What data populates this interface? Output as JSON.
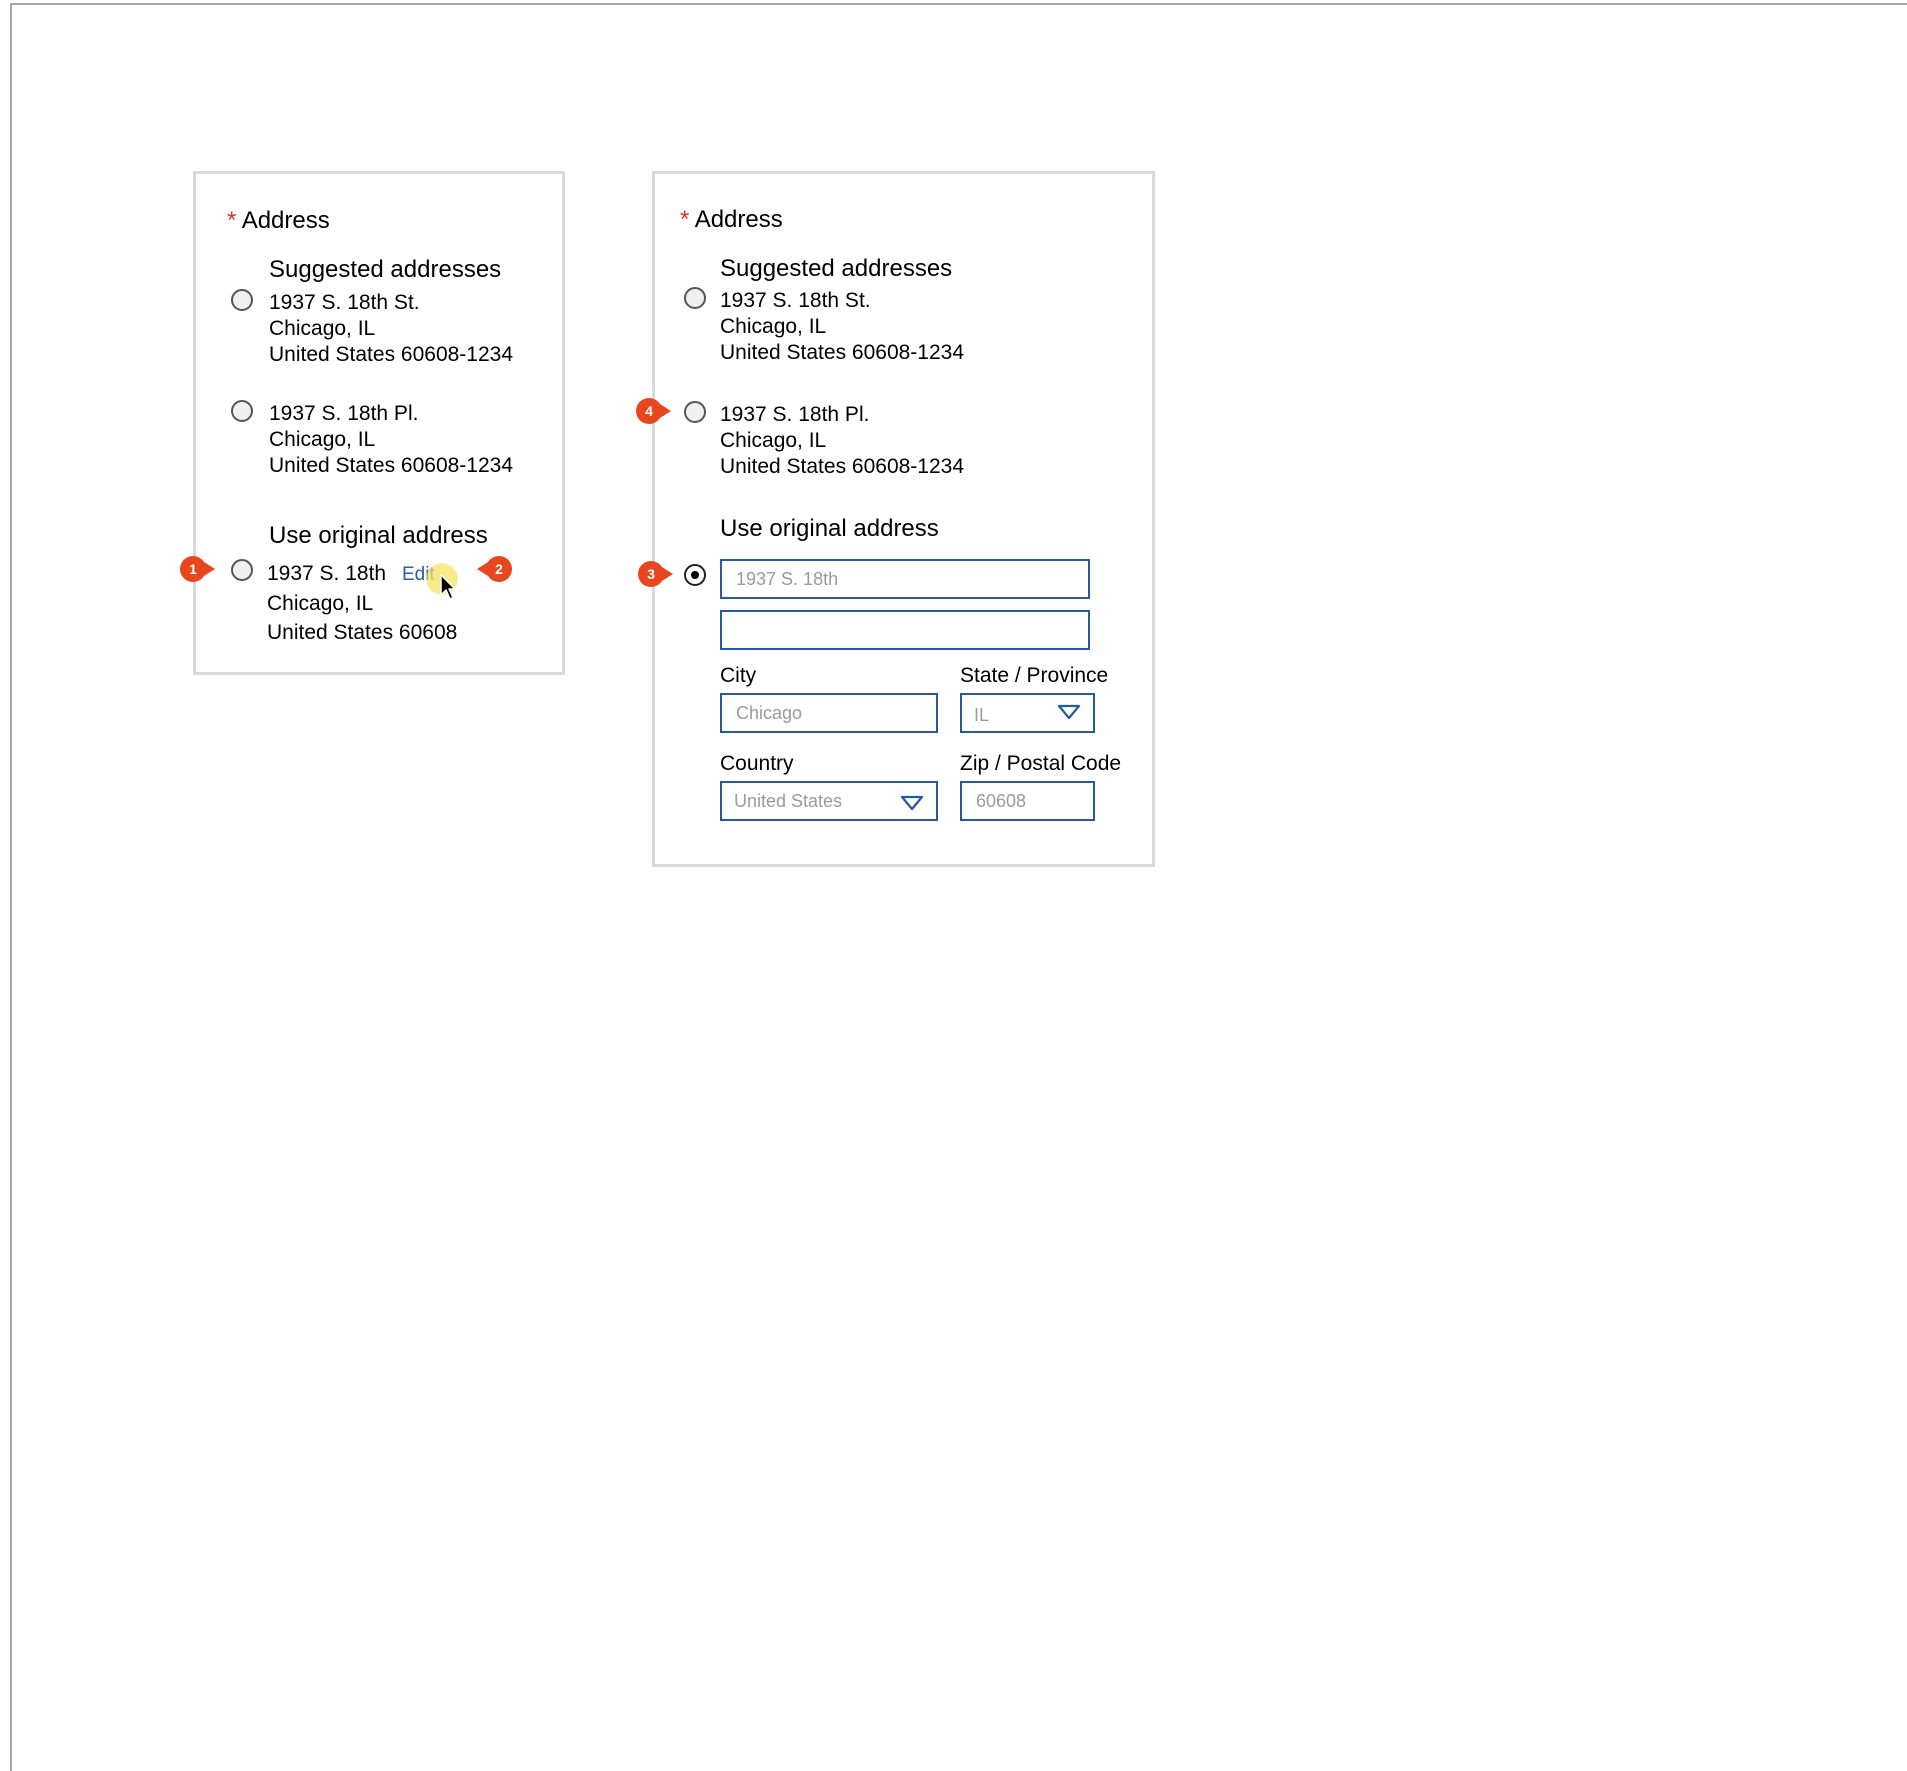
{
  "left_panel": {
    "title": "Address",
    "required_mark": "*",
    "suggested_heading": "Suggested addresses",
    "suggestions": [
      {
        "line1": "1937 S. 18th St.",
        "line2": "Chicago, IL",
        "line3": "United States  60608-1234",
        "selected": false
      },
      {
        "line1": "1937 S. 18th Pl.",
        "line2": "Chicago, IL",
        "line3": "United States  60608-1234",
        "selected": false
      }
    ],
    "original_heading": "Use original address",
    "original": {
      "line1": "1937 S. 18th",
      "line2": "Chicago, IL",
      "line3": "United States 60608",
      "selected": false
    },
    "edit_label": "Edit"
  },
  "right_panel": {
    "title": "Address",
    "required_mark": "*",
    "suggested_heading": "Suggested addresses",
    "suggestions": [
      {
        "line1": "1937 S. 18th St.",
        "line2": "Chicago, IL",
        "line3": "United States  60608-1234",
        "selected": false
      },
      {
        "line1": "1937 S. 18th Pl.",
        "line2": "Chicago, IL",
        "line3": "United States  60608-1234",
        "selected": false
      }
    ],
    "original_heading": "Use original address",
    "original_selected": true,
    "form": {
      "address1_placeholder": "1937 S. 18th",
      "address2_value": "",
      "city_label": "City",
      "city_placeholder": "Chicago",
      "state_label": "State / Province",
      "state_value": "IL",
      "country_label": "Country",
      "country_value": "United States",
      "zip_label": "Zip / Postal Code",
      "zip_placeholder": "60608"
    }
  },
  "annotations": {
    "badge_1": "1",
    "badge_2": "2",
    "badge_3": "3",
    "badge_4": "4"
  },
  "icons": {
    "dropdown": "chevron-down-triangle-outline",
    "cursor": "mouse-pointer-icon"
  },
  "colors": {
    "required": "#e8321e",
    "badge": "#e8461e",
    "field_border": "#2558a5",
    "link": "#2a5db0",
    "panel_border": "#d9d9d9"
  }
}
